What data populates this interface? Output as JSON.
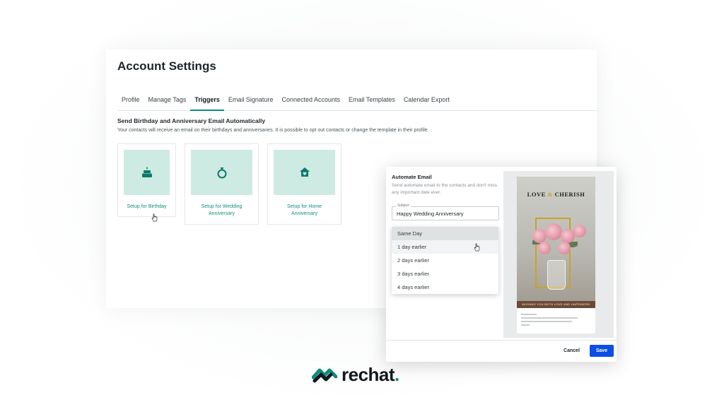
{
  "settings": {
    "title": "Account Settings",
    "tabs": [
      {
        "label": "Profile",
        "active": false
      },
      {
        "label": "Manage Tags",
        "active": false
      },
      {
        "label": "Triggers",
        "active": true
      },
      {
        "label": "Email Signature",
        "active": false
      },
      {
        "label": "Connected Accounts",
        "active": false
      },
      {
        "label": "Email Templates",
        "active": false
      },
      {
        "label": "Calendar Export",
        "active": false
      }
    ],
    "section_title": "Send Birthday and Anniversary Email Automatically",
    "section_desc": "Your contacts will receive an email on their birthdays and anniversaries. It is possible to opt out contacts or change the template in their profile.",
    "cards": [
      {
        "label_line1": "Setup for Birthday",
        "label_line2": "",
        "icon": "cake-icon"
      },
      {
        "label_line1": "Setup for Wedding",
        "label_line2": "Anniversary",
        "icon": "ring-icon"
      },
      {
        "label_line1": "Setup for Home",
        "label_line2": "Anniversary",
        "icon": "home-icon"
      }
    ]
  },
  "modal": {
    "title": "Automate Email",
    "description": "Send automate email to the contacts and don't miss any important date ever.",
    "subject_label": "Subject",
    "subject_value": "Happy Wedding Anniversary",
    "timing_options": [
      {
        "label": "Same Day",
        "state": "selected"
      },
      {
        "label": "1 day earlier",
        "state": "hover"
      },
      {
        "label": "2 days earlier",
        "state": ""
      },
      {
        "label": "3 days earlier",
        "state": ""
      },
      {
        "label": "4 days earlier",
        "state": ""
      }
    ],
    "preview": {
      "heading_left": "LOVE",
      "heading_amp": "&",
      "heading_right": "CHERISH",
      "banner": "WISHING YOU BOTH LOVE AND HAPPINESS!"
    },
    "cancel_label": "Cancel",
    "save_label": "Save"
  },
  "brand": {
    "name": "rechat",
    "dot": ".",
    "accent_color": "#0e8b7a",
    "primary_button_color": "#0c4ee6"
  }
}
